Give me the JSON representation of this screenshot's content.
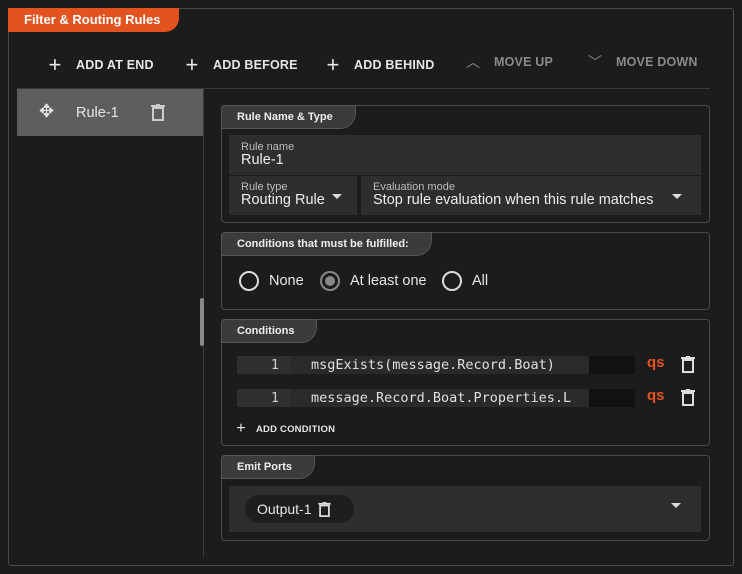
{
  "title": "Filter & Routing Rules",
  "toolbar": {
    "add_at_end": "ADD AT END",
    "add_before": "ADD BEFORE",
    "add_behind": "ADD BEHIND",
    "move_up": "MOVE UP",
    "move_down": "MOVE DOWN"
  },
  "rules": [
    {
      "label": "Rule-1"
    }
  ],
  "name_type": {
    "title": "Rule Name & Type",
    "rule_name_label": "Rule name",
    "rule_name": "Rule-1",
    "rule_type_label": "Rule type",
    "rule_type": "Routing Rule",
    "eval_label": "Evaluation mode",
    "eval_mode": "Stop rule evaluation when this rule matches"
  },
  "fulfilled": {
    "title": "Conditions that must be fulfilled:",
    "options": [
      "None",
      "At least one",
      "All"
    ],
    "selected": "At least one"
  },
  "conditions": {
    "title": "Conditions",
    "items": [
      {
        "line": "1",
        "code": "msgExists(message.Record.Boat)"
      },
      {
        "line": "1",
        "code": "message.Record.Boat.Properties.L"
      }
    ],
    "qs_label": "qs",
    "add_label": "ADD CONDITION"
  },
  "emit": {
    "title": "Emit Ports",
    "chip": "Output-1"
  },
  "colors": {
    "accent": "#e3531f",
    "background": "#1c1c1c"
  }
}
